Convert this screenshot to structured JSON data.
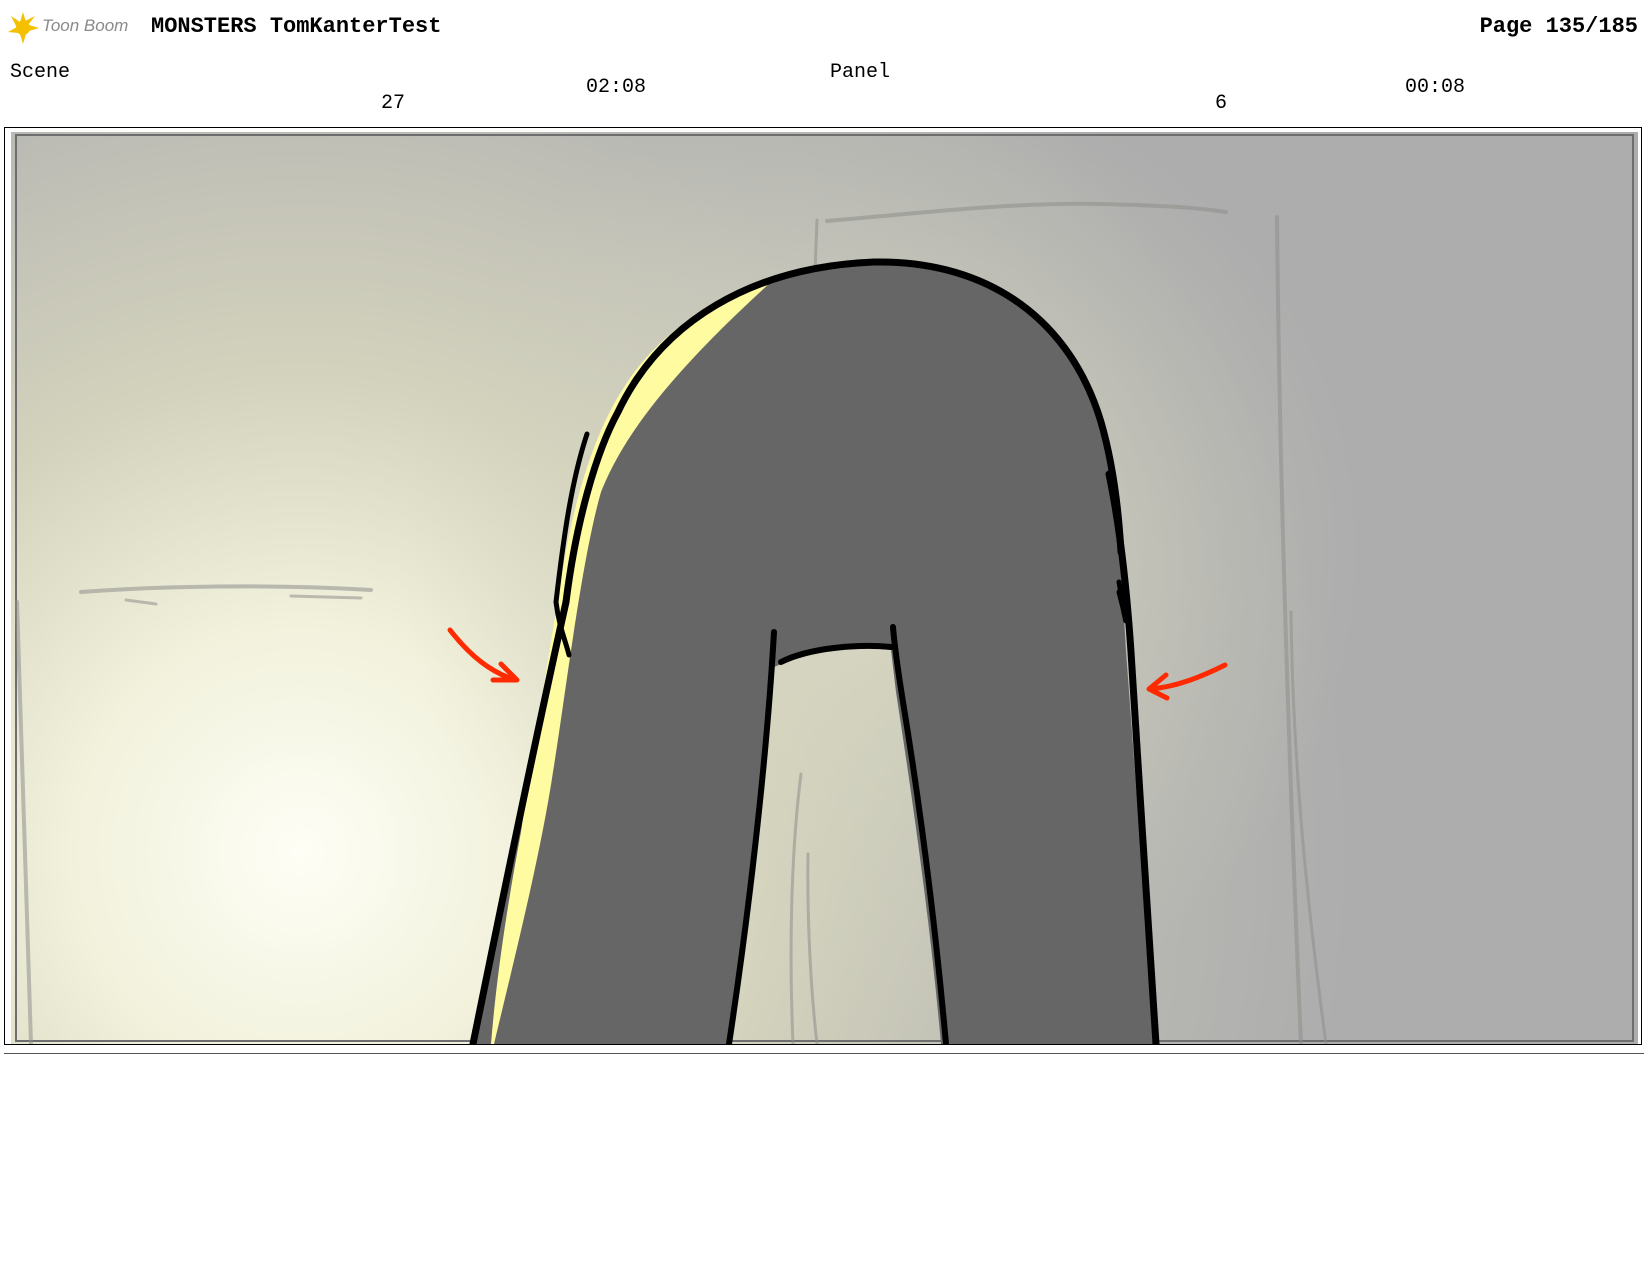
{
  "header": {
    "logo_text": "Toon Boom",
    "project_title": "MONSTERS TomKanterTest",
    "page": "Page 135/185"
  },
  "scene": {
    "label": "Scene",
    "number": "27",
    "duration": "02:08"
  },
  "panel": {
    "label": "Panel",
    "number": "6",
    "duration": "00:08"
  },
  "colors": {
    "arrow": "#ff2a00",
    "figure": "#666666",
    "rim_light": "#fffba0",
    "background": "#b3b3b3"
  },
  "icons": {
    "logo": "toon-boom-star-icon"
  }
}
